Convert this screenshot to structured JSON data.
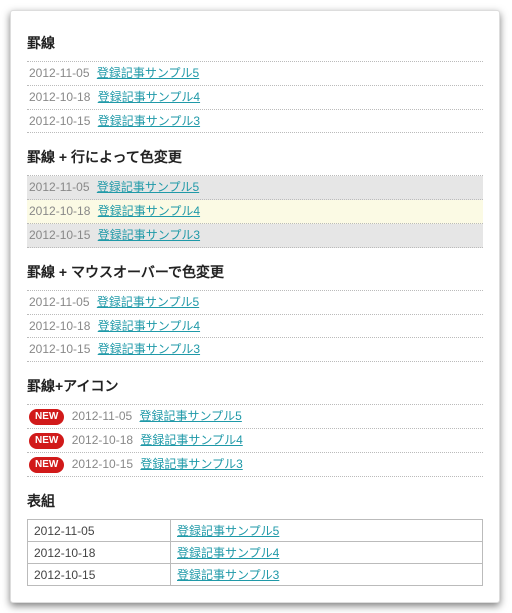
{
  "badge_text": "NEW",
  "sections": {
    "s1": {
      "title": "罫線"
    },
    "s2": {
      "title": "罫線 + 行によって色変更"
    },
    "s3": {
      "title": "罫線 + マウスオーバーで色変更"
    },
    "s4": {
      "title": "罫線+アイコン"
    },
    "s5": {
      "title": "表組"
    }
  },
  "articles": [
    {
      "date": "2012-11-05",
      "title": "登録記事サンプル5"
    },
    {
      "date": "2012-10-18",
      "title": "登録記事サンプル4"
    },
    {
      "date": "2012-10-15",
      "title": "登録記事サンプル3"
    }
  ]
}
